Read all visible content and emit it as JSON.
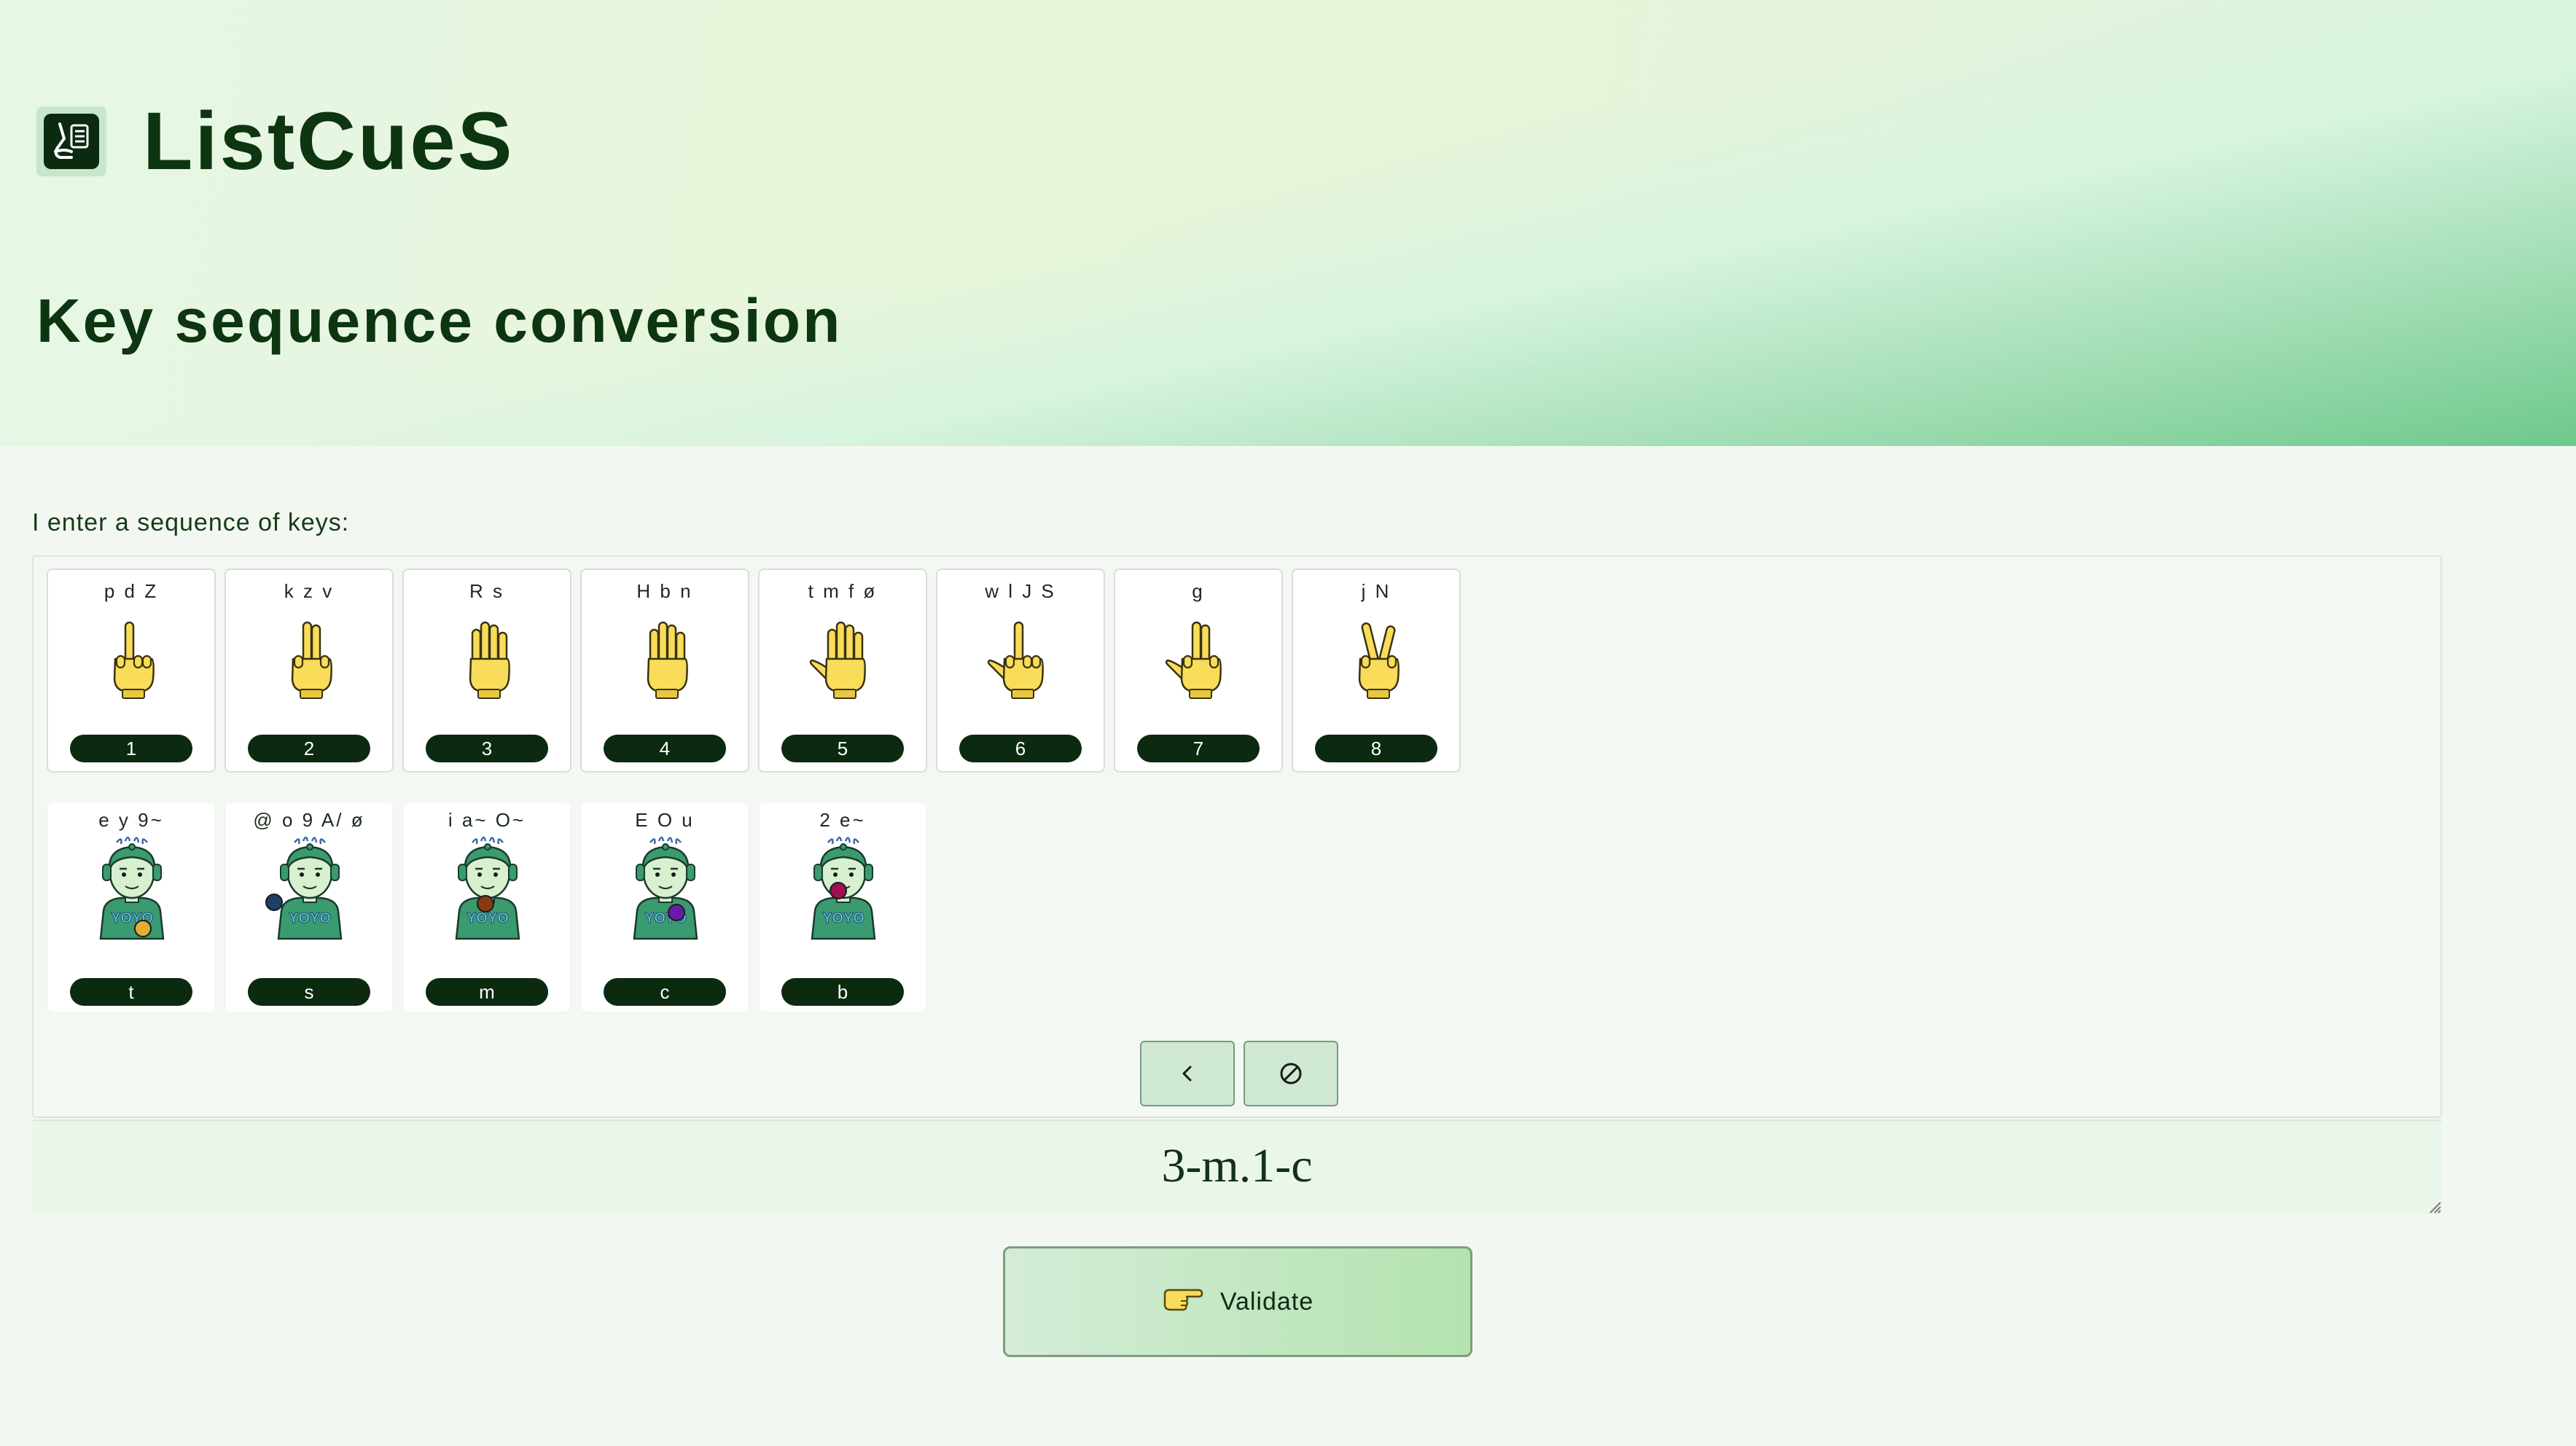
{
  "app": {
    "title": "ListCueS"
  },
  "page": {
    "title": "Key sequence conversion",
    "prompt": "I enter a sequence of keys:"
  },
  "hand_keys": [
    {
      "letters": "p d Z",
      "number": "1"
    },
    {
      "letters": "k z v",
      "number": "2"
    },
    {
      "letters": "R s",
      "number": "3"
    },
    {
      "letters": "H b n",
      "number": "4"
    },
    {
      "letters": "t m f ø",
      "number": "5"
    },
    {
      "letters": "w l J S",
      "number": "6"
    },
    {
      "letters": "g",
      "number": "7"
    },
    {
      "letters": "j N",
      "number": "8"
    }
  ],
  "vowel_keys": [
    {
      "letters": "e y 9~",
      "code": "t",
      "dot_color": "#e2b030"
    },
    {
      "letters": "@ o 9 A/ ø",
      "code": "s",
      "dot_color": "#1f3f66"
    },
    {
      "letters": "i a~ O~",
      "code": "m",
      "dot_color": "#8a3a10"
    },
    {
      "letters": "E O u",
      "code": "c",
      "dot_color": "#6a1aa8"
    },
    {
      "letters": "2 e~",
      "code": "b",
      "dot_color": "#a01050"
    }
  ],
  "shirt_text": "YOYO",
  "controls": {
    "backspace_icon": "chevron-left-icon",
    "clear_icon": "prohibited-icon"
  },
  "output": {
    "value": "3-m.1-c"
  },
  "validate": {
    "label": "Validate",
    "icon": "pointing-hand-icon"
  },
  "colors": {
    "dark_green": "#0b2a10",
    "hand_yellow": "#f8dc5a",
    "button_green": "#cfe8d2"
  }
}
